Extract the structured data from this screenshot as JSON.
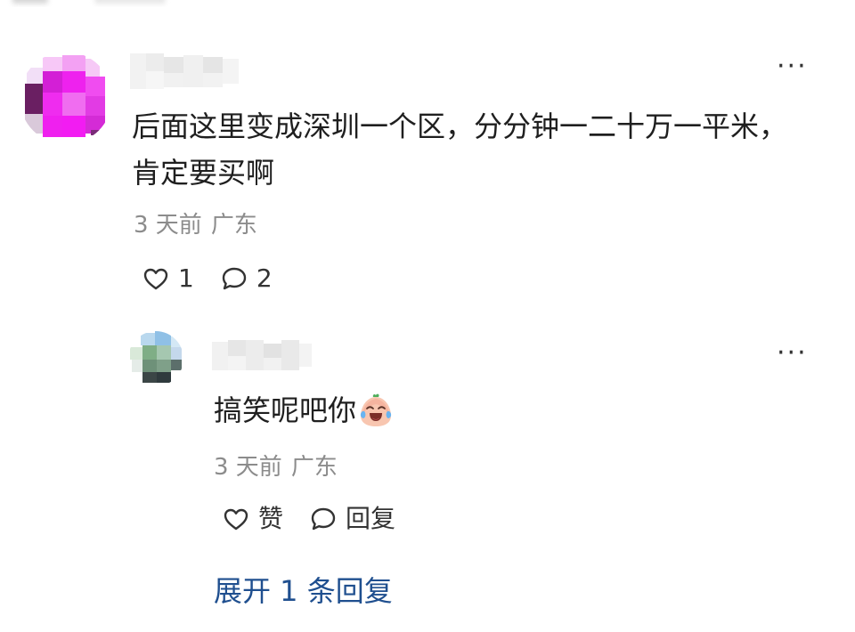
{
  "comment": {
    "text": "后面这里变成深圳一个区，分分钟一二十万一平米，肯定要买啊",
    "time": "3 天前",
    "location": "广东",
    "like_count": "1",
    "reply_count": "2",
    "more_label": "···"
  },
  "reply": {
    "text": "搞笑呢吧你",
    "emoji": "crying-laughing-face-emoji",
    "time": "3 天前",
    "location": "广东",
    "like_label": "赞",
    "reply_label": "回复",
    "more_label": "···"
  },
  "expand_label": "展开 1 条回复",
  "colors": {
    "link": "#1f4f8f",
    "meta": "#8c8c8c",
    "text": "#1f1f1f"
  },
  "icons": {
    "like": "heart-outline-icon",
    "comment": "speech-bubble-outline-icon",
    "more": "more-horizontal-icon"
  }
}
